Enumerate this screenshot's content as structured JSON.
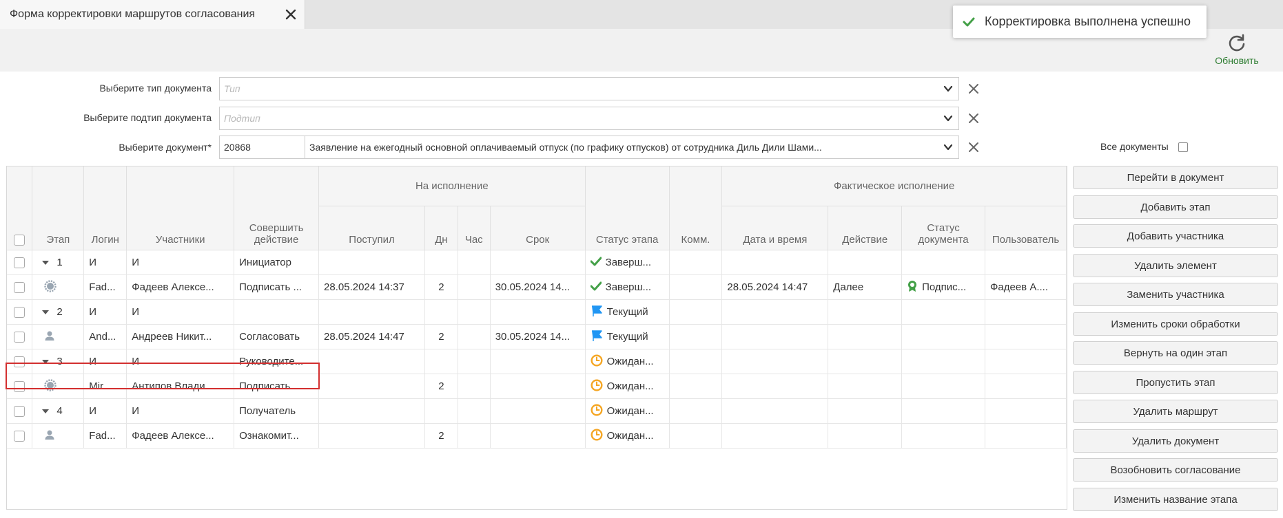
{
  "tab": {
    "title": "Форма корректировки маршрутов согласования"
  },
  "toast": {
    "message": "Корректировка выполнена успешно"
  },
  "toolbar": {
    "refresh_label": "Обновить"
  },
  "form": {
    "doc_type_label": "Выберите тип документа",
    "doc_type_placeholder": "Тип",
    "doc_subtype_label": "Выберите подтип документа",
    "doc_subtype_placeholder": "Подтип",
    "doc_label": "Выберите документ*",
    "doc_number": "20868",
    "doc_name": "Заявление на ежегодный основной оплачиваемый отпуск (по графику отпусков) от сотрудника Диль Дили Шами...",
    "all_docs_label": "Все документы"
  },
  "table": {
    "headers": {
      "stage": "Этап",
      "login": "Логин",
      "participants": "Участники",
      "action": "Совершить действие",
      "group_exec": "На исполнение",
      "received": "Поступил",
      "days": "Дн",
      "hours": "Час",
      "deadline": "Срок",
      "stage_status": "Статус этапа",
      "comment": "Комм.",
      "group_fact": "Фактическое исполнение",
      "datetime": "Дата и время",
      "fact_action": "Действие",
      "doc_status": "Статус документа",
      "user": "Пользователь"
    },
    "rows": [
      {
        "kind": "stage",
        "stage": "1",
        "login": "И",
        "participant": "И",
        "action": "Инициатор",
        "received": "",
        "days": "",
        "hours": "",
        "deadline": "",
        "status_icon": "check-icon",
        "status": "Заверш...",
        "comment": "",
        "datetime": "",
        "fact_action": "",
        "doc_status_icon": "",
        "doc_status": "",
        "user": ""
      },
      {
        "kind": "person",
        "icon": "gear-person-icon",
        "login": "Fad...",
        "participant": "Фадеев Алексе...",
        "action": "Подписать ...",
        "received": "28.05.2024 14:37",
        "days": "2",
        "hours": "",
        "deadline": "30.05.2024 14...",
        "status_icon": "check-icon",
        "status": "Заверш...",
        "comment": "",
        "datetime": "28.05.2024 14:47",
        "fact_action": "Далее",
        "doc_status_icon": "award-icon",
        "doc_status": "Подпис...",
        "user": "Фадеев А...."
      },
      {
        "kind": "stage",
        "stage": "2",
        "login": "И",
        "participant": "И",
        "action": "",
        "received": "",
        "days": "",
        "hours": "",
        "deadline": "",
        "status_icon": "flag-icon",
        "status": "Текущий",
        "comment": "",
        "datetime": "",
        "fact_action": "",
        "doc_status_icon": "",
        "doc_status": "",
        "user": ""
      },
      {
        "kind": "person",
        "icon": "person-icon",
        "login": "And...",
        "participant": "Андреев Никит...",
        "action": "Согласовать",
        "received": "28.05.2024 14:47",
        "days": "2",
        "hours": "",
        "deadline": "30.05.2024 14...",
        "status_icon": "flag-icon",
        "status": "Текущий",
        "comment": "",
        "datetime": "",
        "fact_action": "",
        "doc_status_icon": "",
        "doc_status": "",
        "user": ""
      },
      {
        "kind": "stage",
        "stage": "3",
        "login": "И",
        "participant": "И",
        "action": "Руководите...",
        "received": "",
        "days": "",
        "hours": "",
        "deadline": "",
        "status_icon": "clock-icon",
        "status": "Ожидан...",
        "comment": "",
        "datetime": "",
        "fact_action": "",
        "doc_status_icon": "",
        "doc_status": "",
        "user": ""
      },
      {
        "kind": "person",
        "icon": "gear-person-icon",
        "login": "Mir...",
        "participant": "Антипов Влади...",
        "action": "Подписать ...",
        "received": "",
        "days": "2",
        "hours": "",
        "deadline": "",
        "status_icon": "clock-icon",
        "status": "Ожидан...",
        "comment": "",
        "datetime": "",
        "fact_action": "",
        "doc_status_icon": "",
        "doc_status": "",
        "user": ""
      },
      {
        "kind": "stage",
        "stage": "4",
        "login": "И",
        "participant": "И",
        "action": "Получатель",
        "received": "",
        "days": "",
        "hours": "",
        "deadline": "",
        "status_icon": "clock-icon",
        "status": "Ожидан...",
        "comment": "",
        "datetime": "",
        "fact_action": "",
        "doc_status_icon": "",
        "doc_status": "",
        "user": ""
      },
      {
        "kind": "person",
        "icon": "person-icon",
        "login": "Fad...",
        "participant": "Фадеев Алексе...",
        "action": "Ознакомит...",
        "received": "",
        "days": "2",
        "hours": "",
        "deadline": "",
        "status_icon": "clock-icon",
        "status": "Ожидан...",
        "comment": "",
        "datetime": "",
        "fact_action": "",
        "doc_status_icon": "",
        "doc_status": "",
        "user": ""
      }
    ]
  },
  "actions": [
    "Перейти в документ",
    "Добавить этап",
    "Добавить участника",
    "Удалить элемент",
    "Заменить участника",
    "Изменить сроки обработки",
    "Вернуть на один этап",
    "Пропустить этап",
    "Удалить маршрут",
    "Удалить документ",
    "Возобновить согласование",
    "Изменить название этапа"
  ],
  "colors": {
    "accent_green": "#2e7d32",
    "check_green": "#43a047",
    "flag_blue": "#2196f3",
    "clock_orange": "#f5a623",
    "highlight_red": "#d32f2f"
  }
}
